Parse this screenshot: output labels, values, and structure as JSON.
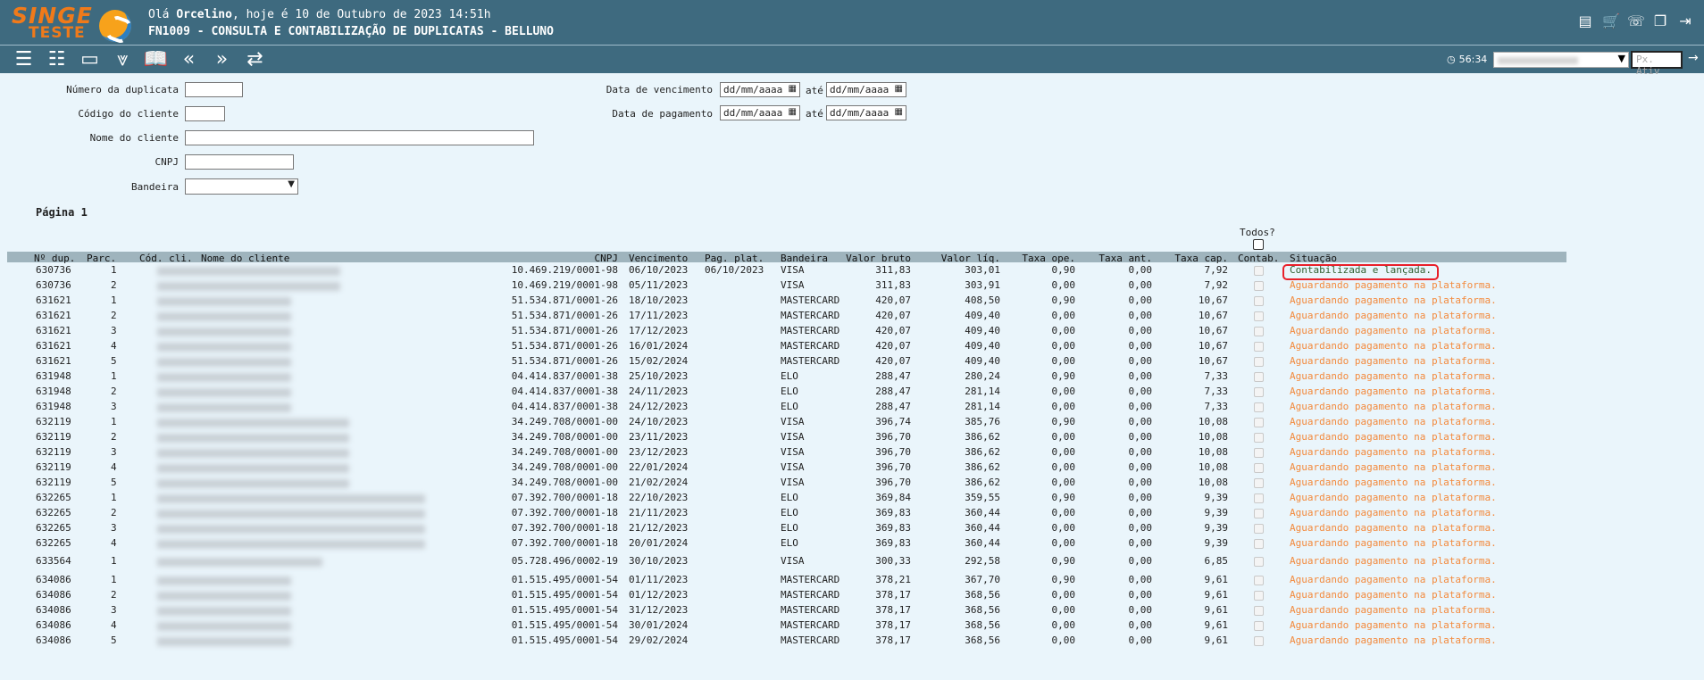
{
  "header": {
    "logo_line1": "SINGE",
    "logo_line2": "TESTE",
    "greeting_prefix": "Olá ",
    "user_name": "Orcelino",
    "greeting_suffix": ", hoje é 10 de Outubro de 2023 14:51h",
    "screen_title": "FN1009 - CONSULTA E CONTABILIZAÇÃO DE DUPLICATAS - BELLUNO",
    "icons": [
      "document-icon",
      "cart-icon",
      "support-icon",
      "windows-icon",
      "logout-icon"
    ]
  },
  "toolbar": {
    "icons": [
      "list-icon",
      "checklist-icon",
      "card-list-icon",
      "collapse-all-icon",
      "book-icon",
      "previous-icon",
      "next-icon",
      "switch-icon"
    ],
    "timer": "56:34",
    "px_placeholder": "Px. Ativ"
  },
  "form": {
    "numero_label": "Número da duplicata",
    "codigo_label": "Código do cliente",
    "nome_label": "Nome do cliente",
    "cnpj_label": "CNPJ",
    "bandeira_label": "Bandeira",
    "venc_label": "Data de vencimento",
    "pag_label": "Data de pagamento",
    "ate": "até",
    "date_placeholder": "dd/mm/aaaa"
  },
  "pagina": "Página 1",
  "todos": "Todos?",
  "table": {
    "headers": {
      "dup": "Nº dup.",
      "parc": "Parc.",
      "cod": "Cód. cli.",
      "nome": "Nome do cliente",
      "cnpj": "CNPJ",
      "venc": "Vencimento",
      "pag": "Pag. plat.",
      "band": "Bandeira",
      "bruto": "Valor bruto",
      "liq": "Valor líq.",
      "ope": "Taxa ope.",
      "ant": "Taxa ant.",
      "cap": "Taxa cap.",
      "contab": "Contab.",
      "sit": "Situação"
    },
    "rows": [
      {
        "dup": "630736",
        "parc": "1",
        "cnpj": "10.469.219/0001-98",
        "venc": "06/10/2023",
        "pag": "06/10/2023",
        "band": "VISA",
        "bruto": "311,83",
        "liq": "303,01",
        "ope": "0,90",
        "ant": "0,00",
        "cap": "7,92",
        "sit": "Contabilizada e lançada.",
        "ok": true
      },
      {
        "dup": "630736",
        "parc": "2",
        "cnpj": "10.469.219/0001-98",
        "venc": "05/11/2023",
        "pag": "",
        "band": "VISA",
        "bruto": "311,83",
        "liq": "303,91",
        "ope": "0,00",
        "ant": "0,00",
        "cap": "7,92",
        "sit": "Aguardando pagamento na plataforma.",
        "ok": false
      },
      {
        "dup": "631621",
        "parc": "1",
        "cnpj": "51.534.871/0001-26",
        "venc": "18/10/2023",
        "pag": "",
        "band": "MASTERCARD",
        "bruto": "420,07",
        "liq": "408,50",
        "ope": "0,90",
        "ant": "0,00",
        "cap": "10,67",
        "sit": "Aguardando pagamento na plataforma.",
        "ok": false
      },
      {
        "dup": "631621",
        "parc": "2",
        "cnpj": "51.534.871/0001-26",
        "venc": "17/11/2023",
        "pag": "",
        "band": "MASTERCARD",
        "bruto": "420,07",
        "liq": "409,40",
        "ope": "0,00",
        "ant": "0,00",
        "cap": "10,67",
        "sit": "Aguardando pagamento na plataforma.",
        "ok": false
      },
      {
        "dup": "631621",
        "parc": "3",
        "cnpj": "51.534.871/0001-26",
        "venc": "17/12/2023",
        "pag": "",
        "band": "MASTERCARD",
        "bruto": "420,07",
        "liq": "409,40",
        "ope": "0,00",
        "ant": "0,00",
        "cap": "10,67",
        "sit": "Aguardando pagamento na plataforma.",
        "ok": false
      },
      {
        "dup": "631621",
        "parc": "4",
        "cnpj": "51.534.871/0001-26",
        "venc": "16/01/2024",
        "pag": "",
        "band": "MASTERCARD",
        "bruto": "420,07",
        "liq": "409,40",
        "ope": "0,00",
        "ant": "0,00",
        "cap": "10,67",
        "sit": "Aguardando pagamento na plataforma.",
        "ok": false
      },
      {
        "dup": "631621",
        "parc": "5",
        "cnpj": "51.534.871/0001-26",
        "venc": "15/02/2024",
        "pag": "",
        "band": "MASTERCARD",
        "bruto": "420,07",
        "liq": "409,40",
        "ope": "0,00",
        "ant": "0,00",
        "cap": "10,67",
        "sit": "Aguardando pagamento na plataforma.",
        "ok": false
      },
      {
        "dup": "631948",
        "parc": "1",
        "cnpj": "04.414.837/0001-38",
        "venc": "25/10/2023",
        "pag": "",
        "band": "ELO",
        "bruto": "288,47",
        "liq": "280,24",
        "ope": "0,90",
        "ant": "0,00",
        "cap": "7,33",
        "sit": "Aguardando pagamento na plataforma.",
        "ok": false
      },
      {
        "dup": "631948",
        "parc": "2",
        "cnpj": "04.414.837/0001-38",
        "venc": "24/11/2023",
        "pag": "",
        "band": "ELO",
        "bruto": "288,47",
        "liq": "281,14",
        "ope": "0,00",
        "ant": "0,00",
        "cap": "7,33",
        "sit": "Aguardando pagamento na plataforma.",
        "ok": false
      },
      {
        "dup": "631948",
        "parc": "3",
        "cnpj": "04.414.837/0001-38",
        "venc": "24/12/2023",
        "pag": "",
        "band": "ELO",
        "bruto": "288,47",
        "liq": "281,14",
        "ope": "0,00",
        "ant": "0,00",
        "cap": "7,33",
        "sit": "Aguardando pagamento na plataforma.",
        "ok": false
      },
      {
        "dup": "632119",
        "parc": "1",
        "cnpj": "34.249.708/0001-00",
        "venc": "24/10/2023",
        "pag": "",
        "band": "VISA",
        "bruto": "396,74",
        "liq": "385,76",
        "ope": "0,90",
        "ant": "0,00",
        "cap": "10,08",
        "sit": "Aguardando pagamento na plataforma.",
        "ok": false
      },
      {
        "dup": "632119",
        "parc": "2",
        "cnpj": "34.249.708/0001-00",
        "venc": "23/11/2023",
        "pag": "",
        "band": "VISA",
        "bruto": "396,70",
        "liq": "386,62",
        "ope": "0,00",
        "ant": "0,00",
        "cap": "10,08",
        "sit": "Aguardando pagamento na plataforma.",
        "ok": false
      },
      {
        "dup": "632119",
        "parc": "3",
        "cnpj": "34.249.708/0001-00",
        "venc": "23/12/2023",
        "pag": "",
        "band": "VISA",
        "bruto": "396,70",
        "liq": "386,62",
        "ope": "0,00",
        "ant": "0,00",
        "cap": "10,08",
        "sit": "Aguardando pagamento na plataforma.",
        "ok": false
      },
      {
        "dup": "632119",
        "parc": "4",
        "cnpj": "34.249.708/0001-00",
        "venc": "22/01/2024",
        "pag": "",
        "band": "VISA",
        "bruto": "396,70",
        "liq": "386,62",
        "ope": "0,00",
        "ant": "0,00",
        "cap": "10,08",
        "sit": "Aguardando pagamento na plataforma.",
        "ok": false
      },
      {
        "dup": "632119",
        "parc": "5",
        "cnpj": "34.249.708/0001-00",
        "venc": "21/02/2024",
        "pag": "",
        "band": "VISA",
        "bruto": "396,70",
        "liq": "386,62",
        "ope": "0,00",
        "ant": "0,00",
        "cap": "10,08",
        "sit": "Aguardando pagamento na plataforma.",
        "ok": false
      },
      {
        "dup": "632265",
        "parc": "1",
        "cnpj": "07.392.700/0001-18",
        "venc": "22/10/2023",
        "pag": "",
        "band": "ELO",
        "bruto": "369,84",
        "liq": "359,55",
        "ope": "0,90",
        "ant": "0,00",
        "cap": "9,39",
        "sit": "Aguardando pagamento na plataforma.",
        "ok": false
      },
      {
        "dup": "632265",
        "parc": "2",
        "cnpj": "07.392.700/0001-18",
        "venc": "21/11/2023",
        "pag": "",
        "band": "ELO",
        "bruto": "369,83",
        "liq": "360,44",
        "ope": "0,00",
        "ant": "0,00",
        "cap": "9,39",
        "sit": "Aguardando pagamento na plataforma.",
        "ok": false
      },
      {
        "dup": "632265",
        "parc": "3",
        "cnpj": "07.392.700/0001-18",
        "venc": "21/12/2023",
        "pag": "",
        "band": "ELO",
        "bruto": "369,83",
        "liq": "360,44",
        "ope": "0,00",
        "ant": "0,00",
        "cap": "9,39",
        "sit": "Aguardando pagamento na plataforma.",
        "ok": false
      },
      {
        "dup": "632265",
        "parc": "4",
        "cnpj": "07.392.700/0001-18",
        "venc": "20/01/2024",
        "pag": "",
        "band": "ELO",
        "bruto": "369,83",
        "liq": "360,44",
        "ope": "0,00",
        "ant": "0,00",
        "cap": "9,39",
        "sit": "Aguardando pagamento na plataforma.",
        "ok": false
      },
      {
        "dup": "633564",
        "parc": "1",
        "cnpj": "05.728.496/0002-19",
        "venc": "30/10/2023",
        "pag": "",
        "band": "VISA",
        "bruto": "300,33",
        "liq": "292,58",
        "ope": "0,90",
        "ant": "0,00",
        "cap": "6,85",
        "sit": "Aguardando pagamento na plataforma.",
        "ok": false
      },
      {
        "dup": "634086",
        "parc": "1",
        "cnpj": "01.515.495/0001-54",
        "venc": "01/11/2023",
        "pag": "",
        "band": "MASTERCARD",
        "bruto": "378,21",
        "liq": "367,70",
        "ope": "0,90",
        "ant": "0,00",
        "cap": "9,61",
        "sit": "Aguardando pagamento na plataforma.",
        "ok": false
      },
      {
        "dup": "634086",
        "parc": "2",
        "cnpj": "01.515.495/0001-54",
        "venc": "01/12/2023",
        "pag": "",
        "band": "MASTERCARD",
        "bruto": "378,17",
        "liq": "368,56",
        "ope": "0,00",
        "ant": "0,00",
        "cap": "9,61",
        "sit": "Aguardando pagamento na plataforma.",
        "ok": false
      },
      {
        "dup": "634086",
        "parc": "3",
        "cnpj": "01.515.495/0001-54",
        "venc": "31/12/2023",
        "pag": "",
        "band": "MASTERCARD",
        "bruto": "378,17",
        "liq": "368,56",
        "ope": "0,00",
        "ant": "0,00",
        "cap": "9,61",
        "sit": "Aguardando pagamento na plataforma.",
        "ok": false
      },
      {
        "dup": "634086",
        "parc": "4",
        "cnpj": "01.515.495/0001-54",
        "venc": "30/01/2024",
        "pag": "",
        "band": "MASTERCARD",
        "bruto": "378,17",
        "liq": "368,56",
        "ope": "0,00",
        "ant": "0,00",
        "cap": "9,61",
        "sit": "Aguardando pagamento na plataforma.",
        "ok": false
      },
      {
        "dup": "634086",
        "parc": "5",
        "cnpj": "01.515.495/0001-54",
        "venc": "29/02/2024",
        "pag": "",
        "band": "MASTERCARD",
        "bruto": "378,17",
        "liq": "368,56",
        "ope": "0,00",
        "ant": "0,00",
        "cap": "9,61",
        "sit": "Aguardando pagamento na plataforma.",
        "ok": false
      }
    ]
  }
}
